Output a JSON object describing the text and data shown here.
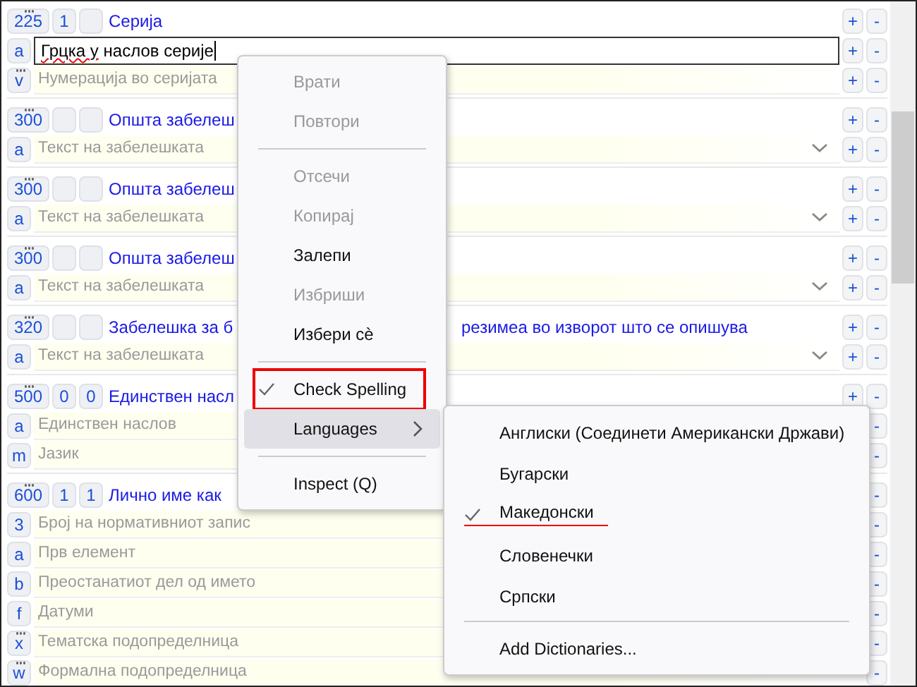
{
  "fields": [
    {
      "tag": "225",
      "repeatable": true,
      "ind1": "1",
      "title": "Серија",
      "add": "+",
      "remove": "-",
      "subfields": [
        {
          "code": "a",
          "repeatable": false,
          "value_parts": [
            {
              "text": "Грцка у",
              "misspelled": true
            },
            {
              "text": "наслов серије",
              "misspelled": false
            }
          ],
          "focused": true,
          "add": "+",
          "remove": "-"
        },
        {
          "code": "v",
          "repeatable": true,
          "placeholder": "Нумерација во серијата",
          "focused": false,
          "add": "+",
          "remove": "-"
        }
      ]
    },
    {
      "tag": "300",
      "repeatable": true,
      "title": "Општа забелеш",
      "add": "+",
      "remove": "-",
      "subfields": [
        {
          "code": "a",
          "repeatable": false,
          "placeholder": "Текст на забелешката",
          "focused": false,
          "dropdown": true,
          "add": "+",
          "remove": "-"
        }
      ]
    },
    {
      "tag": "300",
      "repeatable": true,
      "title": "Општа забелеш",
      "add": "+",
      "remove": "-",
      "subfields": [
        {
          "code": "a",
          "repeatable": false,
          "placeholder": "Текст на забелешката",
          "focused": false,
          "dropdown": true,
          "add": "+",
          "remove": "-"
        }
      ]
    },
    {
      "tag": "300",
      "repeatable": true,
      "title": "Општа забелеш",
      "add": "+",
      "remove": "-",
      "subfields": [
        {
          "code": "a",
          "repeatable": false,
          "placeholder": "Текст на забелешката",
          "focused": false,
          "dropdown": true,
          "add": "+",
          "remove": "-"
        }
      ]
    },
    {
      "tag": "320",
      "repeatable": true,
      "title": "Забелешка за б",
      "title_continued": "резимеа во изворот што се опишува",
      "add": "+",
      "remove": "-",
      "subfields": [
        {
          "code": "a",
          "repeatable": false,
          "placeholder": "Текст на забелешката",
          "focused": false,
          "dropdown": true,
          "add": "+",
          "remove": "-"
        }
      ]
    },
    {
      "tag": "500",
      "repeatable": true,
      "ind1": "0",
      "ind2": "0",
      "title": "Единствен насл",
      "add": "+",
      "remove": "-",
      "subfields": [
        {
          "code": "a",
          "repeatable": false,
          "placeholder": "Единствен наслов",
          "focused": false,
          "remove": "-"
        },
        {
          "code": "m",
          "repeatable": false,
          "placeholder": "Јазик",
          "focused": false,
          "remove": "-"
        }
      ]
    },
    {
      "tag": "600",
      "repeatable": true,
      "ind1": "1",
      "ind2": "1",
      "title": "Лично име как",
      "remove": "-",
      "subfields": [
        {
          "code": "3",
          "repeatable": false,
          "placeholder": "Број на нормативниот запис",
          "focused": false,
          "remove": "-"
        },
        {
          "code": "a",
          "repeatable": false,
          "placeholder": "Прв елемент",
          "focused": false,
          "remove": "-"
        },
        {
          "code": "b",
          "repeatable": false,
          "placeholder": "Преостанатиот дел од името",
          "focused": false,
          "remove": "-"
        },
        {
          "code": "f",
          "repeatable": false,
          "placeholder": "Датуми",
          "focused": false,
          "remove": "-"
        },
        {
          "code": "x",
          "repeatable": true,
          "placeholder": "Тематска подопределница",
          "focused": false,
          "remove": "-"
        },
        {
          "code": "w",
          "repeatable": true,
          "placeholder": "Формална подопределница",
          "focused": false,
          "remove": "-"
        }
      ]
    }
  ],
  "context_menu": {
    "items": [
      {
        "kind": "item",
        "label": "Врати",
        "disabled": true,
        "checked": false,
        "highlighted": false,
        "annotated": false
      },
      {
        "kind": "item",
        "label": "Повтори",
        "disabled": true,
        "checked": false,
        "highlighted": false,
        "annotated": false
      },
      {
        "kind": "separator"
      },
      {
        "kind": "item",
        "label": "Отсечи",
        "disabled": true,
        "checked": false,
        "highlighted": false,
        "annotated": false
      },
      {
        "kind": "item",
        "label": "Копирај",
        "disabled": true,
        "checked": false,
        "highlighted": false,
        "annotated": false
      },
      {
        "kind": "item",
        "label": "Залепи",
        "disabled": false,
        "checked": false,
        "highlighted": false,
        "annotated": false
      },
      {
        "kind": "item",
        "label": "Избриши",
        "disabled": true,
        "checked": false,
        "highlighted": false,
        "annotated": false
      },
      {
        "kind": "item",
        "label": "Избери сѐ",
        "disabled": false,
        "checked": false,
        "highlighted": false,
        "annotated": false
      },
      {
        "kind": "separator"
      },
      {
        "kind": "item",
        "label": "Check Spelling",
        "disabled": false,
        "checked": true,
        "highlighted": false,
        "annotated": true
      },
      {
        "kind": "submenu",
        "label": "Languages",
        "disabled": false,
        "checked": false,
        "highlighted": true,
        "annotated": false
      },
      {
        "kind": "separator"
      },
      {
        "kind": "item",
        "label": "Inspect (Q)",
        "disabled": false,
        "checked": false,
        "highlighted": false,
        "annotated": false
      }
    ]
  },
  "languages_submenu": {
    "items": [
      {
        "kind": "item",
        "label": "Англиски (Соединети Американски Држави)",
        "checked": false,
        "annotated": false
      },
      {
        "kind": "item",
        "label": "Бугарски",
        "checked": false,
        "annotated": false
      },
      {
        "kind": "item",
        "label": "Македонски",
        "checked": true,
        "annotated": true
      },
      {
        "kind": "item",
        "label": "Словенечки",
        "checked": false,
        "annotated": false
      },
      {
        "kind": "item",
        "label": "Српски",
        "checked": false,
        "annotated": false
      },
      {
        "kind": "separator"
      },
      {
        "kind": "item",
        "label": "Add Dictionaries...",
        "checked": false,
        "annotated": false
      }
    ]
  }
}
